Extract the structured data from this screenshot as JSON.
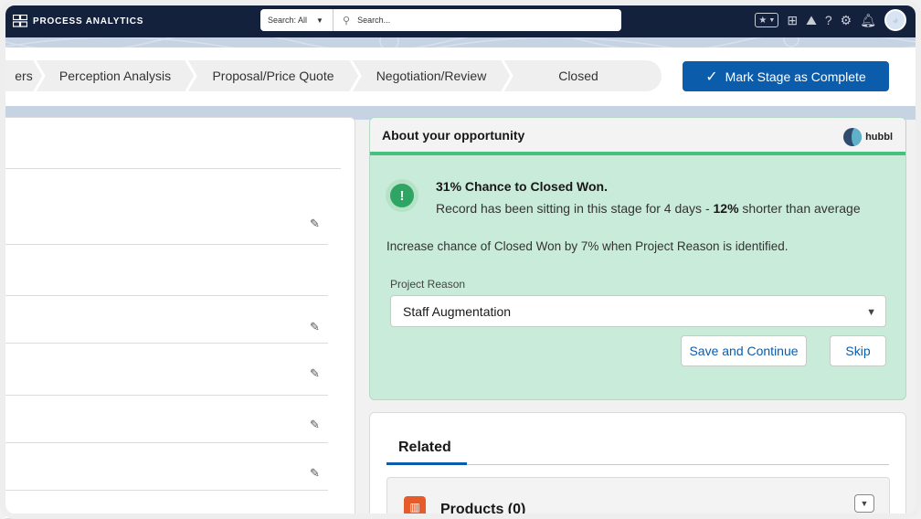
{
  "app": {
    "title": "PROCESS ANALYTICS"
  },
  "search": {
    "scope": "Search: All",
    "placeholder": "Search..."
  },
  "path": {
    "stages": [
      "ers",
      "Perception Analysis",
      "Proposal/Price Quote",
      "Negotiation/Review",
      "Closed"
    ],
    "mark_complete_label": "Mark Stage as Complete"
  },
  "opportunity": {
    "title": "About your opportunity",
    "brand": "hubbl",
    "alert_icon": "!",
    "chance_title": "31% Chance to Closed Won.",
    "sitting_prefix": "Record has been sitting in this stage for 4 days - ",
    "sitting_bold": "12%",
    "sitting_suffix": " shorter than average",
    "increase_text": "Increase chance of Closed Won by 7% when Project Reason is identified.",
    "field_label": "Project Reason",
    "field_value": "Staff Augmentation",
    "save_label": "Save and Continue",
    "skip_label": "Skip"
  },
  "related": {
    "tab_label": "Related",
    "products_label": "Products (0)"
  },
  "colors": {
    "topbar": "#14213d",
    "brand_blue": "#0b5cab",
    "success_bg": "#c9ebd9",
    "success_accent": "#2ea562",
    "products_icon": "#e55b2a"
  },
  "icons": {
    "topbar": [
      "favorites-icon",
      "add-icon",
      "trailhead-icon",
      "help-icon",
      "setup-gear-icon",
      "notification-bell-icon",
      "avatar"
    ]
  }
}
